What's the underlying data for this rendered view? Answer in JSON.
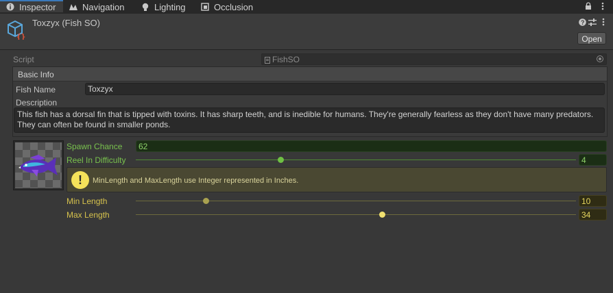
{
  "tabs": [
    {
      "label": "Inspector",
      "icon": "info-icon"
    },
    {
      "label": "Navigation",
      "icon": "navigation-icon"
    },
    {
      "label": "Lighting",
      "icon": "lightbulb-icon"
    },
    {
      "label": "Occlusion",
      "icon": "occlusion-icon"
    }
  ],
  "header": {
    "object_title": "Toxzyx (Fish SO)",
    "open_label": "Open"
  },
  "script": {
    "label": "Script",
    "value": "FishSO"
  },
  "basic_info": {
    "title": "Basic Info",
    "fish_name_label": "Fish Name",
    "fish_name_value": "Toxzyx",
    "description_label": "Description",
    "description_value": "This fish has a dorsal fin that is tipped with toxins. It has sharp teeth, and is inedible for humans. They're generally fearless as they don't have many predators. They can often be found in smaller ponds."
  },
  "stats": {
    "spawn_chance_label": "Spawn Chance",
    "spawn_chance_value": "62",
    "reel_label": "Reel In Difficulty",
    "reel_value": "4",
    "reel_fraction": 0.33,
    "help_text": "MinLength and MaxLength use Integer represented in Inches.",
    "min_length_label": "Min Length",
    "min_length_value": "10",
    "min_length_fraction": 0.16,
    "max_length_label": "Max Length",
    "max_length_value": "34",
    "max_length_fraction": 0.56
  },
  "colors": {
    "accent_blue": "#3a79bb",
    "green": "#79c24e",
    "yellow": "#d6c24d",
    "help_icon": "#f4e15a"
  }
}
